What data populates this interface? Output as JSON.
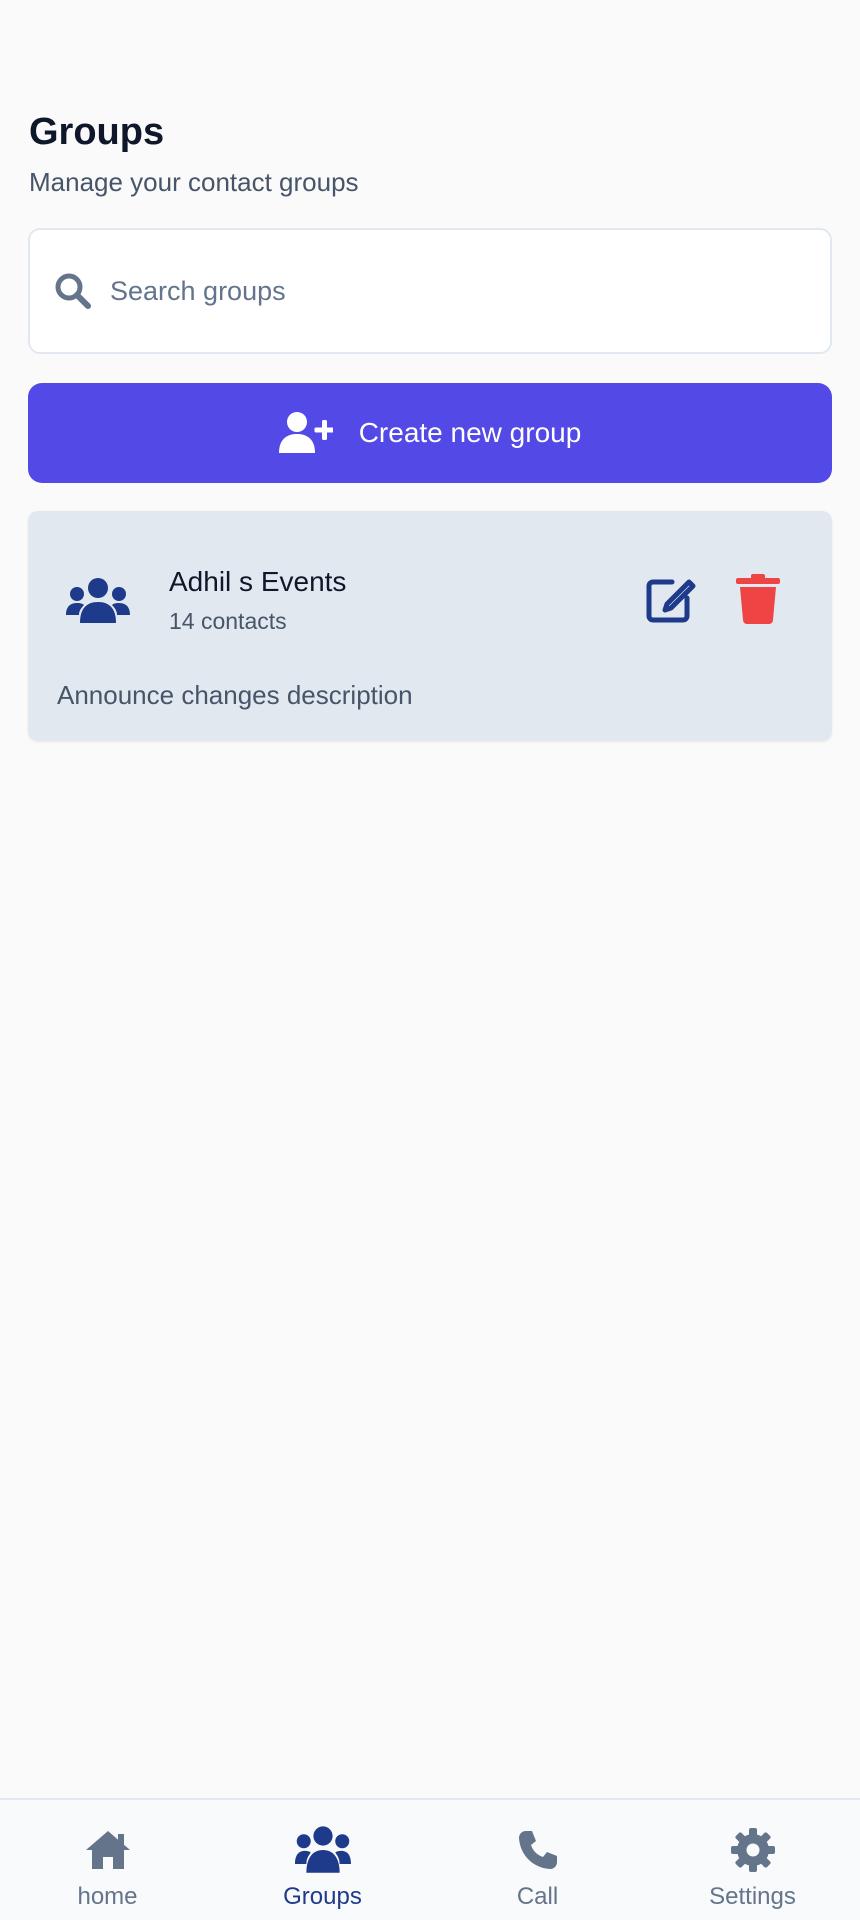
{
  "header": {
    "title": "Groups",
    "subtitle": "Manage your contact groups"
  },
  "search": {
    "placeholder": "Search groups",
    "value": "",
    "icon": "search-icon"
  },
  "create_button": {
    "label": "Create new group",
    "icon": "user-plus-icon"
  },
  "groups": [
    {
      "name": "Adhil s Events",
      "count": "14 contacts",
      "description": "Announce changes description",
      "icon": "users-icon"
    }
  ],
  "nav": {
    "items": [
      {
        "label": "home",
        "icon": "home-icon",
        "active": false
      },
      {
        "label": "Groups",
        "icon": "users-icon",
        "active": true
      },
      {
        "label": "Call",
        "icon": "phone-icon",
        "active": false
      },
      {
        "label": "Settings",
        "icon": "gear-icon",
        "active": false
      }
    ]
  },
  "colors": {
    "primary": "#5249e6",
    "accent_dark": "#1e3a8a",
    "danger": "#ef4444",
    "card_bg": "#e2e8f0",
    "muted": "#64748b",
    "page_bg": "#fafafa"
  }
}
